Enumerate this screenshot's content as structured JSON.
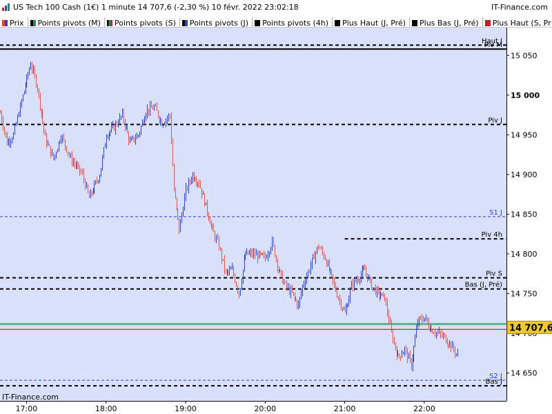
{
  "header": {
    "title": "US Tech 100 Cash (1€) 1 minute 14 707,6 (-2,30 %) 10 févr. 2022 23:02:18",
    "brand": "IT-Finance.com"
  },
  "legend": [
    {
      "label": "Prix",
      "colors": [
        "#e04040",
        "#3040c0"
      ]
    },
    {
      "label": "Points pivots (M)",
      "colors": [
        "#000000",
        "#2e8b57"
      ]
    },
    {
      "label": "Points pivots (S)",
      "colors": [
        "#000000",
        "#2e8b57",
        "#c02020"
      ]
    },
    {
      "label": "Points pivots (J)",
      "colors": [
        "#000000",
        "#3040c0"
      ]
    },
    {
      "label": "Points pivots (4h)",
      "colors": [
        "#000000"
      ]
    },
    {
      "label": "Plus Haut (J, Pré)",
      "colors": [
        "#000000"
      ]
    },
    {
      "label": "Plus Bas (J, Pré)",
      "colors": [
        "#000000"
      ]
    },
    {
      "label": "Plus Haut (S, Pr",
      "colors": [
        "#c02020"
      ]
    }
  ],
  "watermark": "IT-Finance.com",
  "colors": {
    "plot_background": "#d8e0fa",
    "up_bar": "#3040c0",
    "down_bar": "#e85050",
    "last_price_box": "#f0c830",
    "green_band": "#3aa060"
  },
  "chart_data": {
    "type": "ohlc",
    "title": "US Tech 100 Cash (1€) 1 minute",
    "x_ticks": [
      "17:00",
      "18:00",
      "19:00",
      "20:00",
      "21:00",
      "22:00"
    ],
    "x_range": [
      "16:40",
      "23:02"
    ],
    "y_ticks": [
      14650,
      14700,
      14750,
      14800,
      14850,
      14900,
      14950,
      15000,
      15050
    ],
    "y_tick_labels": [
      "14 650",
      "14 700",
      "14 750",
      "14 800",
      "14 850",
      "14 900",
      "14 950",
      "15 000",
      "15 050"
    ],
    "ylim": [
      14615,
      15085
    ],
    "last_price": 14707.6,
    "last_price_label": "14 707,6",
    "grid": false,
    "levels": [
      {
        "name": "Haut J",
        "value": 15063,
        "style": "dashed",
        "color": "#000000",
        "from": "16:40"
      },
      {
        "name": "Piv M",
        "value": 15058,
        "style": "solid",
        "color": "#000000",
        "from": "16:40"
      },
      {
        "name": "Piv J",
        "value": 14963,
        "style": "dashed",
        "color": "#000000",
        "from": "16:40"
      },
      {
        "name": "S1 J",
        "value": 14847,
        "style": "dashed",
        "color": "#3040c0",
        "from": "16:40"
      },
      {
        "name": "Piv 4h",
        "value": 14819,
        "style": "dashed",
        "color": "#000000",
        "from": "21:00"
      },
      {
        "name": "Piv S",
        "value": 14770,
        "style": "dashed",
        "color": "#000000",
        "from": "16:40"
      },
      {
        "name": "Bas (J, Pré)",
        "value": 14756,
        "style": "dashed",
        "color": "#000000",
        "from": "16:40"
      },
      {
        "name": "",
        "value": 14712,
        "style": "solid",
        "color": "#3aa060",
        "from": "16:40"
      },
      {
        "name": "",
        "value": 14705,
        "style": "solid",
        "color": "#c03030",
        "from": "16:40"
      },
      {
        "name": "S2 J",
        "value": 14641,
        "style": "dashed",
        "color": "#3040c0",
        "from": "16:40"
      },
      {
        "name": "Bas J",
        "value": 14634,
        "style": "dashed",
        "color": "#000000",
        "from": "16:40"
      }
    ],
    "series": [
      {
        "name": "Prix",
        "waypoints": [
          [
            "16:40",
            14978
          ],
          [
            "16:45",
            14940
          ],
          [
            "16:50",
            14950
          ],
          [
            "16:55",
            14985
          ],
          [
            "17:00",
            15020
          ],
          [
            "17:03",
            15040
          ],
          [
            "17:08",
            15010
          ],
          [
            "17:14",
            14945
          ],
          [
            "17:20",
            14920
          ],
          [
            "17:26",
            14950
          ],
          [
            "17:33",
            14920
          ],
          [
            "17:42",
            14900
          ],
          [
            "17:47",
            14870
          ],
          [
            "17:55",
            14900
          ],
          [
            "18:00",
            14950
          ],
          [
            "18:06",
            14960
          ],
          [
            "18:12",
            14975
          ],
          [
            "18:18",
            14940
          ],
          [
            "18:24",
            14950
          ],
          [
            "18:30",
            14980
          ],
          [
            "18:36",
            14985
          ],
          [
            "18:42",
            14965
          ],
          [
            "18:48",
            14975
          ],
          [
            "18:51",
            14880
          ],
          [
            "18:55",
            14830
          ],
          [
            "19:00",
            14880
          ],
          [
            "19:05",
            14900
          ],
          [
            "19:10",
            14890
          ],
          [
            "19:15",
            14860
          ],
          [
            "19:20",
            14830
          ],
          [
            "19:25",
            14810
          ],
          [
            "19:30",
            14775
          ],
          [
            "19:35",
            14780
          ],
          [
            "19:40",
            14750
          ],
          [
            "19:45",
            14800
          ],
          [
            "19:50",
            14800
          ],
          [
            "20:00",
            14795
          ],
          [
            "20:05",
            14815
          ],
          [
            "20:10",
            14780
          ],
          [
            "20:15",
            14760
          ],
          [
            "20:20",
            14750
          ],
          [
            "20:25",
            14735
          ],
          [
            "20:28",
            14760
          ],
          [
            "20:35",
            14790
          ],
          [
            "20:40",
            14810
          ],
          [
            "20:45",
            14795
          ],
          [
            "20:50",
            14770
          ],
          [
            "20:55",
            14745
          ],
          [
            "21:00",
            14725
          ],
          [
            "21:05",
            14760
          ],
          [
            "21:10",
            14770
          ],
          [
            "21:15",
            14780
          ],
          [
            "21:20",
            14760
          ],
          [
            "21:25",
            14750
          ],
          [
            "21:30",
            14745
          ],
          [
            "21:35",
            14700
          ],
          [
            "21:40",
            14670
          ],
          [
            "21:45",
            14680
          ],
          [
            "21:50",
            14660
          ],
          [
            "21:55",
            14715
          ],
          [
            "22:00",
            14720
          ],
          [
            "22:05",
            14705
          ],
          [
            "22:10",
            14700
          ],
          [
            "22:15",
            14695
          ],
          [
            "22:20",
            14685
          ],
          [
            "22:25",
            14672
          ]
        ]
      }
    ]
  }
}
